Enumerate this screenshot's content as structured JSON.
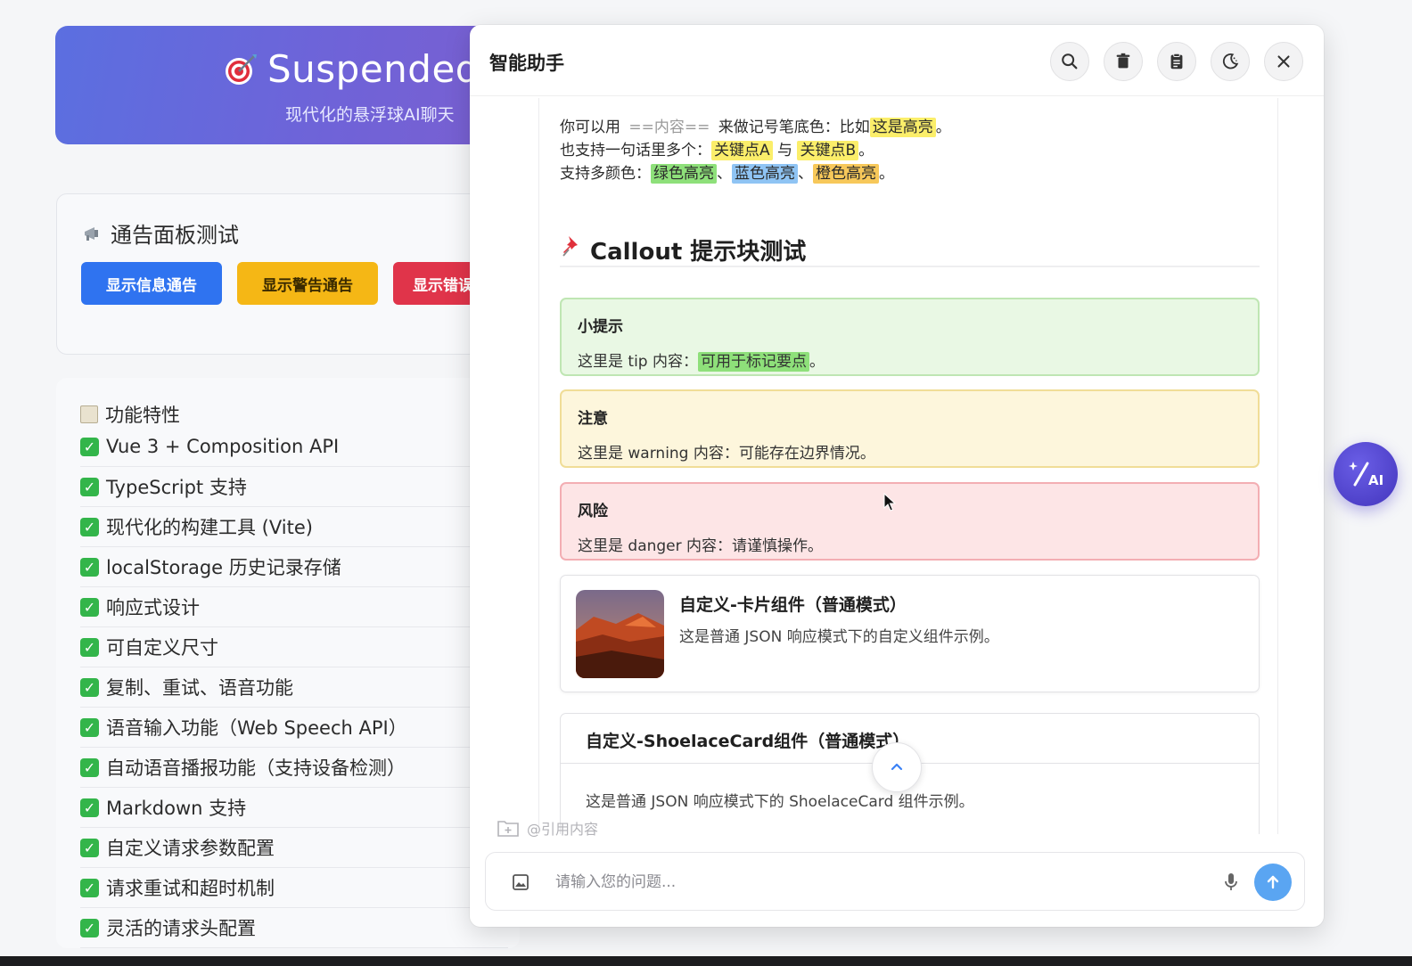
{
  "page": {
    "hero": {
      "title": "Suspended",
      "subtitle": "现代化的悬浮球AI聊天"
    },
    "notice": {
      "title": "通告面板测试",
      "buttons": {
        "info": "显示信息通告",
        "warning": "显示警告通告",
        "error": "显示错误通告"
      }
    },
    "features": {
      "heading": "功能特性",
      "items": [
        "Vue 3 + Composition API",
        "TypeScript 支持",
        "现代化的构建工具 (Vite)",
        "localStorage 历史记录存储",
        "响应式设计",
        "可自定义尺寸",
        "复制、重试、语音功能",
        "语音输入功能（Web Speech API）",
        "自动语音播报功能（支持设备检测）",
        "Markdown 支持",
        "自定义请求参数配置",
        "请求重试和超时机制",
        "灵活的请求头配置"
      ]
    }
  },
  "assistant": {
    "title": "智能助手",
    "header_icons": [
      "search-icon",
      "trash-icon",
      "clipboard-icon",
      "moon-icon",
      "close-icon"
    ],
    "highlight": {
      "line1_prefix": "你可以用",
      "line1_code": "==内容==",
      "line1_mid": "来做记号笔底色：比如",
      "line1_mark": "这是高亮",
      "line1_end": "。",
      "line2_prefix": "也支持一句话里多个：",
      "line2_mark_a": "关键点A",
      "line2_mid": "与",
      "line2_mark_b": "关键点B",
      "line2_end": "。",
      "line3_prefix": "支持多颜色：",
      "green": "绿色高亮",
      "sep1": "、",
      "blue": "蓝色高亮",
      "sep2": "、",
      "orange": "橙色高亮",
      "line3_end": "。"
    },
    "callout_heading": "Callout 提示块测试",
    "callouts": {
      "tip": {
        "title": "小提示",
        "text": "这里是 tip 内容：",
        "mark": "可用于标记要点",
        "end": "。"
      },
      "warning": {
        "title": "注意",
        "text": "这里是 warning 内容：可能存在边界情况。"
      },
      "danger": {
        "title": "风险",
        "text": "这里是 danger 内容：请谨慎操作。"
      }
    },
    "card": {
      "title": "自定义-卡片组件（普通模式）",
      "desc": "这是普通 JSON 响应模式下的自定义组件示例。"
    },
    "shoelace": {
      "title": "自定义-ShoelaceCard组件（普通模式）",
      "desc": "这是普通 JSON 响应模式下的 ShoelaceCard 组件示例。"
    },
    "quote_label": "@引用内容",
    "input": {
      "placeholder": "请输入您的问题...",
      "value": ""
    },
    "fab_label": "AI"
  },
  "colors": {
    "accent": "#2f73f0",
    "warning": "#f5b715",
    "danger": "#e0344a",
    "success": "#33b54a",
    "send": "#5aa5f2",
    "fab": "#4b3fd0"
  }
}
